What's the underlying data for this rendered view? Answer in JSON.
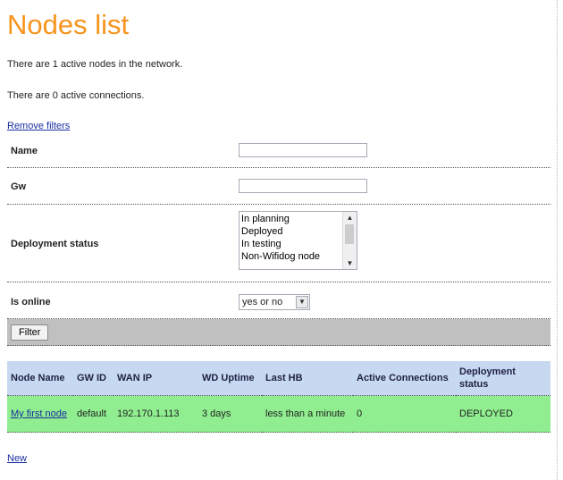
{
  "page": {
    "title": "Nodes list",
    "active_nodes_text": "There are 1 active nodes in the network.",
    "active_connections_text": "There are 0 active connections.",
    "remove_filters_label": "Remove filters",
    "new_label": "New"
  },
  "filters": {
    "name": {
      "label": "Name",
      "value": ""
    },
    "gw": {
      "label": "Gw",
      "value": ""
    },
    "deployment_status": {
      "label": "Deployment status",
      "options": [
        "In planning",
        "Deployed",
        "In testing",
        "Non-Wifidog node"
      ]
    },
    "is_online": {
      "label": "Is online",
      "selected": "yes or no"
    },
    "filter_button_label": "Filter"
  },
  "table": {
    "headers": {
      "node_name": "Node Name",
      "gw_id": "GW ID",
      "wan_ip": "WAN IP",
      "wd_uptime": "WD Uptime",
      "last_hb": "Last HB",
      "active_connections": "Active Connections",
      "deployment_status": "Deployment status"
    },
    "rows": [
      {
        "node_name": "My first node",
        "gw_id": "default",
        "wan_ip": "192.170.1.113",
        "wd_uptime": "3 days",
        "last_hb": "less than a minute",
        "active_connections": "0",
        "deployment_status": "DEPLOYED"
      }
    ]
  },
  "colors": {
    "title": "#f7941d",
    "header_row": "#c6d9f1",
    "data_row": "#90ee90",
    "filter_bar": "#c0c0c0",
    "link": "#1a2fa0"
  }
}
